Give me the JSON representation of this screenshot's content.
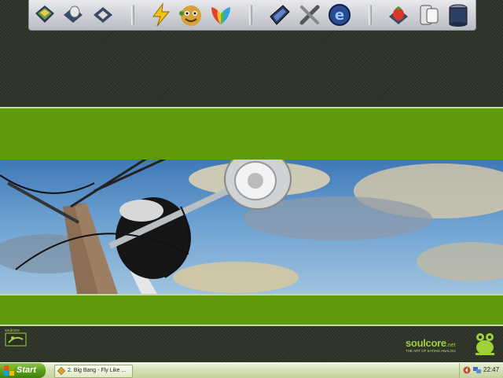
{
  "theme": {
    "accent": "#5f9a0d",
    "background": "#30352a",
    "brand_green": "#9fd137"
  },
  "dock": {
    "groups": [
      {
        "icons": [
          "desktop-icon",
          "mouse-settings-icon",
          "keyboard-icon"
        ]
      },
      {
        "icons": [
          "winamp-icon",
          "buddy-icon",
          "msn-butterfly-icon"
        ]
      },
      {
        "icons": [
          "window-manager-icon",
          "tools-icon",
          "internet-explorer-icon"
        ]
      },
      {
        "icons": [
          "strawberry-icon",
          "system-icon",
          "recycle-bin-icon"
        ]
      }
    ]
  },
  "taskbar": {
    "start_label": "Start",
    "task_label": "2. Big Bang - Fly Like ...",
    "clock": "22:47",
    "tray_icons": [
      "arrow-left-icon",
      "network-icon"
    ]
  },
  "branding": {
    "name": "soulcore",
    "tld": ".net",
    "tagline": "THE ART OF EATING ANALOG",
    "small_logo_caption": "soulcore"
  }
}
